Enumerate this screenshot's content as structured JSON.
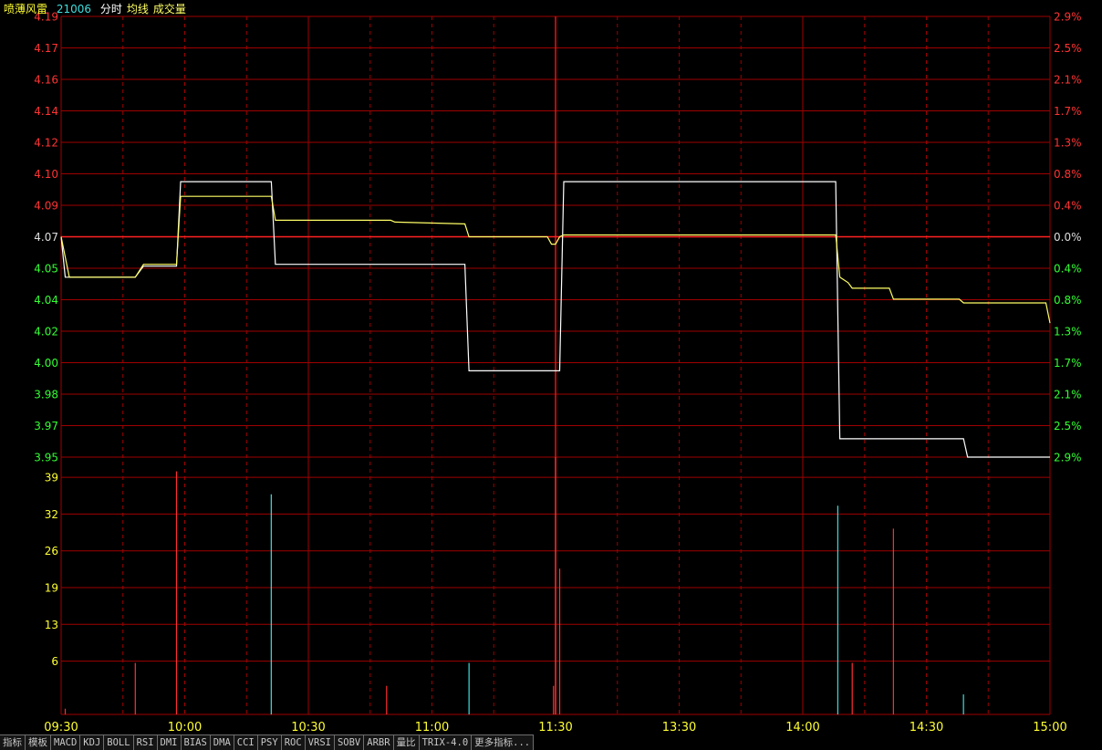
{
  "header": {
    "stock_name": "喷薄风雷",
    "stock_code": "21006",
    "items": [
      "分时",
      "均线",
      "成交量"
    ]
  },
  "colors": {
    "grid": "#a00000",
    "up": "#ff3333",
    "down": "#33ff33",
    "neutral": "#dddddd",
    "price_line": "#ffffff",
    "avg_line": "#ffff66",
    "vol_up": "#ff3030",
    "vol_down": "#40dddd",
    "axis_text": "#ffff33",
    "header_name": "#ffff33",
    "header_code": "#40dddd"
  },
  "chart_data": {
    "type": "line",
    "price_axis": {
      "labels": [
        "4.19",
        "4.17",
        "4.16",
        "4.14",
        "4.12",
        "4.10",
        "4.09",
        "4.07",
        "4.05",
        "4.04",
        "4.02",
        "4.00",
        "3.98",
        "3.97",
        "3.95"
      ],
      "min": 3.95,
      "max": 4.19,
      "prev_close": 4.07
    },
    "pct_axis": {
      "labels": [
        "2.9%",
        "2.5%",
        "2.1%",
        "1.7%",
        "1.3%",
        "0.8%",
        "0.4%",
        "0.0%",
        "0.4%",
        "0.8%",
        "1.3%",
        "1.7%",
        "2.1%",
        "2.5%",
        "2.9%"
      ]
    },
    "volume_axis": {
      "labels": [
        "39",
        "32",
        "26",
        "19",
        "13",
        "6"
      ],
      "max": 45
    },
    "x_axis": {
      "labels": [
        "09:30",
        "10:00",
        "10:30",
        "11:00",
        "11:30",
        "13:30",
        "14:00",
        "14:30",
        "15:00"
      ],
      "minutes": 240
    },
    "series": [
      {
        "points": [
          [
            0,
            4.07
          ],
          [
            1,
            4.048
          ],
          [
            18,
            4.048
          ],
          [
            20,
            4.054
          ],
          [
            27,
            4.054
          ],
          [
            28,
            4.054
          ],
          [
            29,
            4.1
          ],
          [
            51,
            4.1
          ],
          [
            52,
            4.055
          ],
          [
            98,
            4.055
          ],
          [
            99,
            3.997
          ],
          [
            121,
            3.997
          ],
          [
            122,
            4.1
          ],
          [
            188,
            4.1
          ],
          [
            189,
            3.96
          ],
          [
            219,
            3.96
          ],
          [
            220,
            3.95
          ],
          [
            240,
            3.95
          ]
        ]
      },
      {
        "points": [
          [
            0,
            4.07
          ],
          [
            2,
            4.048
          ],
          [
            18,
            4.048
          ],
          [
            20,
            4.055
          ],
          [
            27,
            4.055
          ],
          [
            28,
            4.055
          ],
          [
            29,
            4.092
          ],
          [
            51,
            4.092
          ],
          [
            52,
            4.079
          ],
          [
            80,
            4.079
          ],
          [
            81,
            4.078
          ],
          [
            98,
            4.077
          ],
          [
            99,
            4.07
          ],
          [
            118,
            4.07
          ],
          [
            119,
            4.066
          ],
          [
            120,
            4.066
          ],
          [
            121,
            4.07
          ],
          [
            122,
            4.071
          ],
          [
            188,
            4.071
          ],
          [
            189,
            4.048
          ],
          [
            191,
            4.045
          ],
          [
            192,
            4.042
          ],
          [
            201,
            4.042
          ],
          [
            202,
            4.036
          ],
          [
            218,
            4.036
          ],
          [
            219,
            4.034
          ],
          [
            239,
            4.034
          ],
          [
            240,
            4.023
          ]
        ]
      }
    ],
    "volume": [
      {
        "m": 1,
        "v": 1,
        "dir": "up"
      },
      {
        "m": 18,
        "v": 9,
        "dir": "up"
      },
      {
        "m": 28,
        "v": 42.5,
        "dir": "up"
      },
      {
        "m": 51,
        "v": 38.5,
        "dir": "down"
      },
      {
        "m": 79,
        "v": 5,
        "dir": "up"
      },
      {
        "m": 99,
        "v": 9,
        "dir": "down"
      },
      {
        "m": 119.5,
        "v": 5,
        "dir": "up"
      },
      {
        "m": 120,
        "v": 45,
        "dir": "up"
      },
      {
        "m": 121,
        "v": 25.5,
        "dir": "up"
      },
      {
        "m": 188.5,
        "v": 36.5,
        "dir": "down"
      },
      {
        "m": 192,
        "v": 9,
        "dir": "up"
      },
      {
        "m": 202,
        "v": 32.5,
        "dir": "up"
      },
      {
        "m": 219,
        "v": 3.5,
        "dir": "down"
      }
    ]
  },
  "tabs": [
    "指标",
    "模板",
    "MACD",
    "KDJ",
    "BOLL",
    "RSI",
    "DMI",
    "BIAS",
    "DMA",
    "CCI",
    "PSY",
    "ROC",
    "VRSI",
    "SOBV",
    "ARBR",
    "量比",
    "TRIX-4.0",
    "更多指标..."
  ]
}
